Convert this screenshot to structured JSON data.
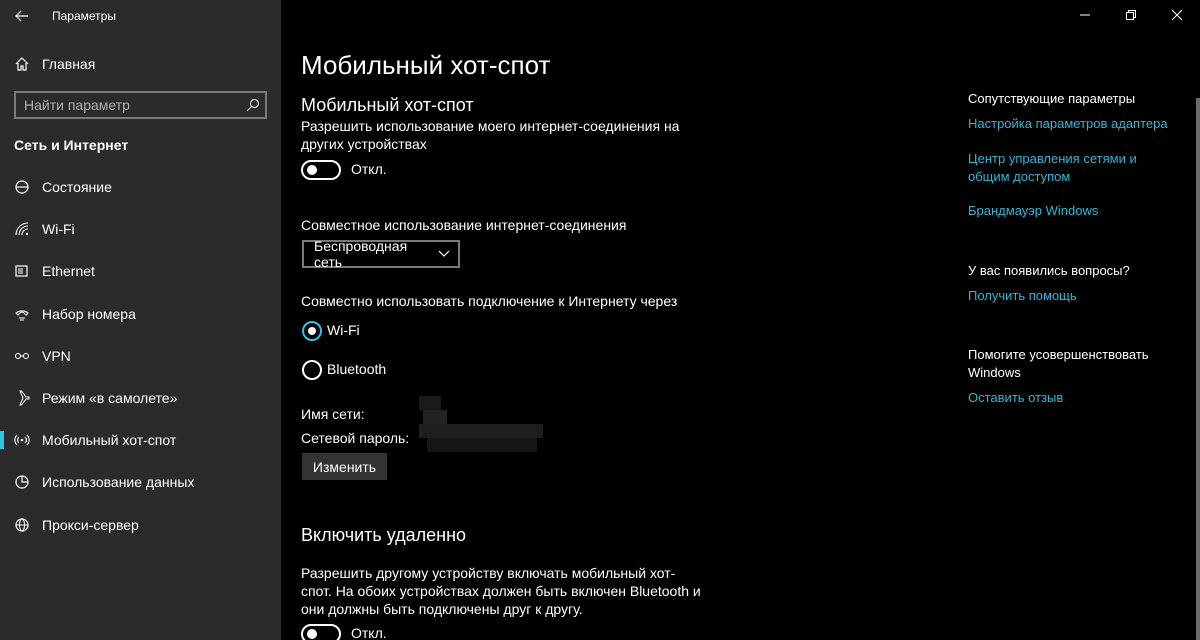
{
  "window": {
    "title": "Параметры"
  },
  "sidebar": {
    "home_label": "Главная",
    "search_placeholder": "Найти параметр",
    "section_title": "Сеть и Интернет",
    "items": [
      {
        "label": "Состояние",
        "icon": "status-icon"
      },
      {
        "label": "Wi-Fi",
        "icon": "wifi-icon"
      },
      {
        "label": "Ethernet",
        "icon": "ethernet-icon"
      },
      {
        "label": "Набор номера",
        "icon": "dialup-icon"
      },
      {
        "label": "VPN",
        "icon": "vpn-icon"
      },
      {
        "label": "Режим «в самолете»",
        "icon": "airplane-icon"
      },
      {
        "label": "Мобильный хот-спот",
        "icon": "hotspot-icon",
        "active": true
      },
      {
        "label": "Использование данных",
        "icon": "data-usage-icon"
      },
      {
        "label": "Прокси-сервер",
        "icon": "proxy-icon"
      }
    ]
  },
  "main": {
    "page_title": "Мобильный хот-спот",
    "hotspot": {
      "heading": "Мобильный хот-спот",
      "description": "Разрешить использование моего интернет-соединения на других устройствах",
      "toggle_state": "Откл."
    },
    "share_connection": {
      "label": "Совместное использование интернет-соединения",
      "selected": "Беспроводная сеть"
    },
    "share_over": {
      "label": "Совместно использовать подключение к Интернету через",
      "options": [
        {
          "label": "Wi-Fi",
          "checked": true
        },
        {
          "label": "Bluetooth",
          "checked": false
        }
      ]
    },
    "network": {
      "name_label": "Имя сети:",
      "password_label": "Сетевой пароль:",
      "change_button": "Изменить"
    },
    "remote": {
      "heading": "Включить удаленно",
      "description": "Разрешить другому устройству включать мобильный хот-спот. На обоих устройствах должен быть включен Bluetooth и они должны быть подключены друг к другу.",
      "toggle_state": "Откл."
    }
  },
  "related": {
    "heading": "Сопутствующие параметры",
    "links": [
      "Настройка параметров адаптера",
      "Центр управления сетями и общим доступом",
      "Брандмауэр Windows"
    ],
    "questions_heading": "У вас появились вопросы?",
    "help_link": "Получить помощь",
    "feedback_heading": "Помогите усовершенствовать Windows",
    "feedback_link": "Оставить отзыв"
  },
  "colors": {
    "accent": "#2cc4e0",
    "link": "#2cb8d6",
    "sidebar_bg": "#2b2b2b",
    "main_bg": "#000000"
  }
}
